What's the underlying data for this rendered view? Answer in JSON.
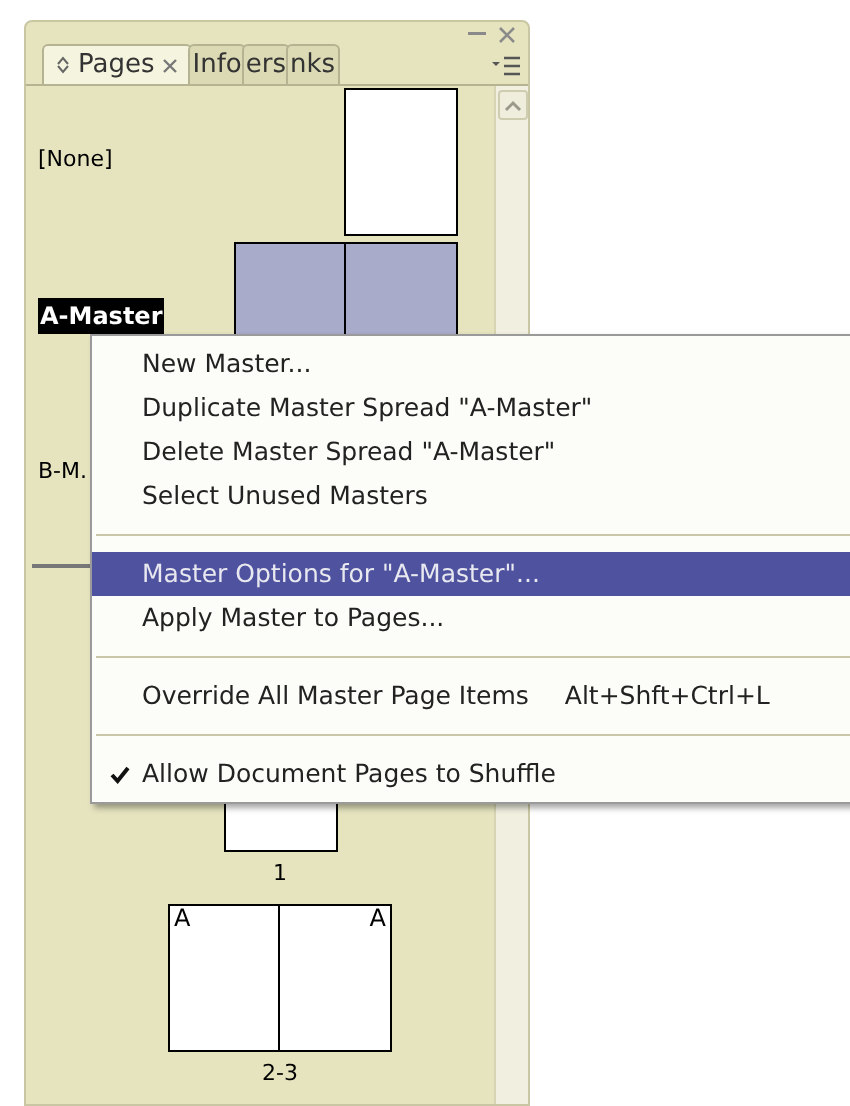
{
  "panel": {
    "tabs": [
      {
        "label": "Pages",
        "selected": true
      },
      {
        "label": "Info",
        "selected": false
      },
      {
        "label": "ers",
        "selected": false
      },
      {
        "label": "nks",
        "selected": false
      }
    ],
    "masters": [
      {
        "label": "[None]",
        "kind": "single",
        "selected": false
      },
      {
        "label": "A-Master",
        "kind": "spread",
        "selected": true
      },
      {
        "label": "B-M.",
        "kind": "hidden",
        "selected": false
      }
    ],
    "pages": [
      {
        "label": "1",
        "kind": "single"
      },
      {
        "label": "2-3",
        "kind": "spread",
        "marks": [
          "A",
          "A"
        ]
      }
    ]
  },
  "context_menu": {
    "items": [
      {
        "kind": "item",
        "label": "New Master...",
        "selected": false,
        "checked": false
      },
      {
        "kind": "item",
        "label": "Duplicate Master Spread \"A-Master\"",
        "selected": false,
        "checked": false
      },
      {
        "kind": "item",
        "label": "Delete Master Spread \"A-Master\"",
        "selected": false,
        "checked": false
      },
      {
        "kind": "item",
        "label": "Select Unused Masters",
        "selected": false,
        "checked": false
      },
      {
        "kind": "separator"
      },
      {
        "kind": "item",
        "label": "Master Options for \"A-Master\"...",
        "selected": true,
        "checked": false
      },
      {
        "kind": "item",
        "label": "Apply Master to Pages...",
        "selected": false,
        "checked": false
      },
      {
        "kind": "separator"
      },
      {
        "kind": "item",
        "label": "Override All Master Page Items",
        "shortcut": "Alt+Shft+Ctrl+L",
        "selected": false,
        "checked": false
      },
      {
        "kind": "separator"
      },
      {
        "kind": "item",
        "label": "Allow Document Pages to Shuffle",
        "selected": false,
        "checked": true
      }
    ]
  }
}
